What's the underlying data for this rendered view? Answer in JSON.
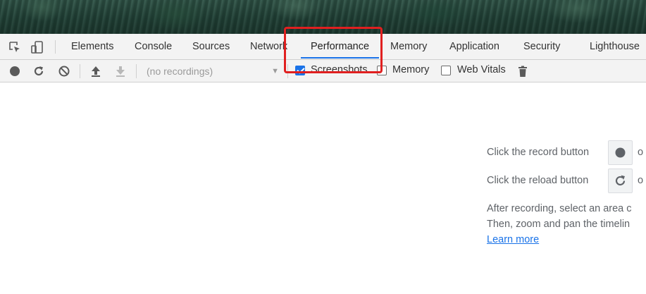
{
  "tabs": {
    "elements": "Elements",
    "console": "Console",
    "sources": "Sources",
    "network": "Network",
    "performance": "Performance",
    "memory": "Memory",
    "application": "Application",
    "security": "Security",
    "lighthouse": "Lighthouse",
    "active": "Performance"
  },
  "toolbar": {
    "recordings_placeholder": "(no recordings)",
    "screenshots_label": "Screenshots",
    "screenshots_checked": true,
    "memory_label": "Memory",
    "memory_checked": false,
    "webvitals_label": "Web Vitals",
    "webvitals_checked": false
  },
  "landing": {
    "record_text": "Click the record button",
    "record_suffix": "o",
    "reload_text": "Click the reload button",
    "reload_suffix": "o",
    "after_text": "After recording, select an area c",
    "then_text": "Then, zoom and pan the timelin",
    "learn_more": "Learn more"
  },
  "colors": {
    "accent": "#1a73e8",
    "highlight": "#e02020"
  },
  "icons": {
    "inspect": "inspect-element-icon",
    "device": "device-toolbar-icon",
    "record": "record-icon",
    "reload": "reload-icon",
    "clear": "clear-icon",
    "upload": "upload-icon",
    "download": "download-icon",
    "trash": "trash-icon"
  }
}
